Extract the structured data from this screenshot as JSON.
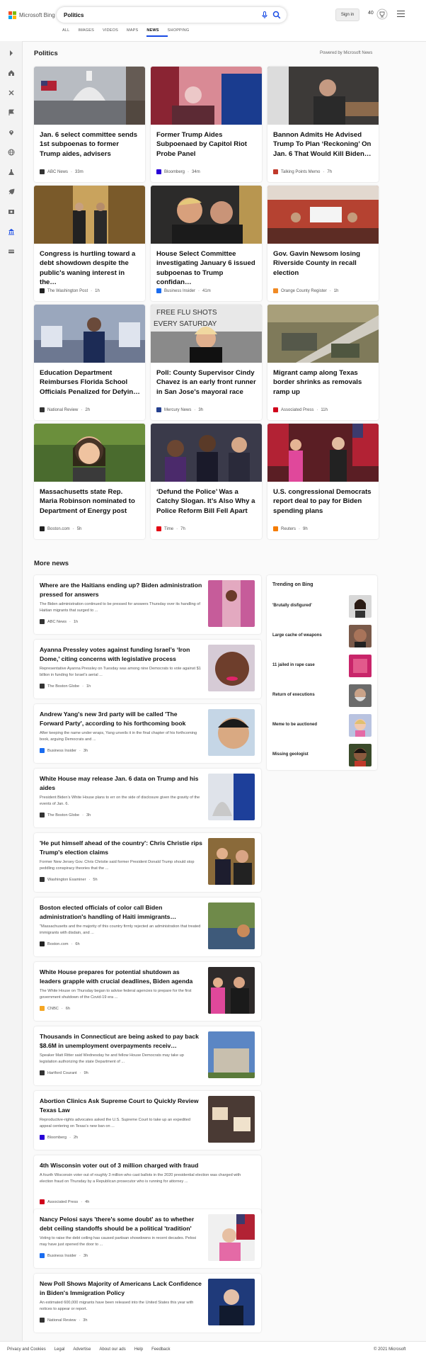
{
  "header": {
    "brand": "Microsoft Bing",
    "search_value": "Politics",
    "sign_in": "Sign in",
    "points": "40",
    "tabs": [
      {
        "label": "ALL"
      },
      {
        "label": "IMAGES"
      },
      {
        "label": "VIDEOS"
      },
      {
        "label": "MAPS"
      },
      {
        "label": "NEWS"
      },
      {
        "label": "SHOPPING"
      }
    ],
    "active_tab": "NEWS"
  },
  "section": {
    "title": "Politics",
    "powered_by": "Powered by Microsoft News"
  },
  "top_stories": [
    {
      "title": "Jan. 6 select committee sends 1st subpoenas to former Trump aides, advisers",
      "source": "ABC News",
      "time": "33m"
    },
    {
      "title": "Former Trump Aides Subpoenaed by Capitol Riot Probe Panel",
      "source": "Bloomberg",
      "time": "34m"
    },
    {
      "title": "Bannon Admits He Advised Trump To Plan ‘Reckoning’ On Jan. 6 That Would Kill Biden…",
      "source": "Talking Points Memo",
      "time": "7h"
    },
    {
      "title": "Congress is hurtling toward a debt showdown despite the public's waning interest in the…",
      "source": "The Washington Post",
      "time": "1h"
    },
    {
      "title": "House Select Committee investigating January 6 issued subpoenas to Trump confidan…",
      "source": "Business Insider",
      "time": "41m"
    },
    {
      "title": "Gov. Gavin Newsom losing Riverside County in recall election",
      "source": "Orange County Register",
      "time": "1h"
    },
    {
      "title": "Education Department Reimburses Florida School Officials Penalized for Defyin…",
      "source": "National Review",
      "time": "2h"
    },
    {
      "title": "Poll: County Supervisor Cindy Chavez is an early front runner in San Jose's mayoral race",
      "source": "Mercury News",
      "time": "3h"
    },
    {
      "title": "Migrant camp along Texas border shrinks as removals ramp up",
      "source": "Associated Press",
      "time": "11h"
    },
    {
      "title": "Massachusetts state Rep. Maria Robinson nominated to Department of Energy post",
      "source": "Boston.com",
      "time": "5h"
    },
    {
      "title": "‘Defund the Police’ Was a Catchy Slogan. It’s Also Why a Police Reform Bill Fell Apart",
      "source": "Time",
      "time": "7h"
    },
    {
      "title": "U.S. congressional Democrats report deal to pay for Biden spending plans",
      "source": "Reuters",
      "time": "9h"
    }
  ],
  "more_news": {
    "title": "More news",
    "items": [
      {
        "title": "Where are the Haitians ending up? Biden administration pressed for answers",
        "desc": "The Biden administration continued to be pressed for answers Thursday over its handling of Haitian migrants that surged to ...",
        "source": "ABC News",
        "time": "1h"
      },
      {
        "title": "Ayanna Pressley votes against funding Israel’s ‘Iron Dome,’ citing concerns with legislative process",
        "desc": "Representative Ayanna Pressley on Tuesday was among nine Democrats to vote against $1 billion in funding for Israel’s aerial ...",
        "source": "The Boston Globe",
        "time": "1h"
      },
      {
        "title": "Andrew Yang's new 3rd party will be called 'The Forward Party', according to his forthcoming book",
        "desc": "After keeping the name under wraps, Yang unveils it in the final chapter of his forthcoming book, arguing Democrats and ...",
        "source": "Business Insider",
        "time": "3h"
      },
      {
        "title": "White House may release Jan. 6 data on Trump and his aides",
        "desc": "President Biden’s White House plans to err on the side of disclosure given the gravity of the events of Jan. 6.",
        "source": "The Boston Globe",
        "time": "3h"
      },
      {
        "title": "'He put himself ahead of the country': Chris Christie rips Trump's election claims",
        "desc": "Former New Jersey Gov. Chris Christie said former President Donald Trump should stop peddling conspiracy theories that the ...",
        "source": "Washington Examiner",
        "time": "5h"
      },
      {
        "title": "Boston elected officials of color call Biden administration's handling of Haiti immigrants…",
        "desc": "\"Massachusetts and the majority of this country firmly rejected an administration that treated immigrants with disdain, and ...",
        "source": "Boston.com",
        "time": "6h"
      },
      {
        "title": "White House prepares for potential shutdown as leaders grapple with crucial deadlines, Biden agenda",
        "desc": "The White House on Thursday began to advise federal agencies to prepare for the first government shutdown of the Covid-19 era ...",
        "source": "CNBC",
        "time": "6h"
      },
      {
        "title": "Thousands in Connecticut are being asked to pay back $8.6M in unemployment overpayments receiv…",
        "desc": "Speaker Matt Ritter said Wednesday he and fellow House Democrats may take up legislation authorizing the state Department of ...",
        "source": "Hartford Courant",
        "time": "9h"
      },
      {
        "title": "Abortion Clinics Ask Supreme Court to Quickly Review Texas Law",
        "desc": "Reproductive-rights advocates asked the U.S. Supreme Court to take up an expedited appeal centering on Texas’s new ban on ...",
        "source": "Bloomberg",
        "time": "2h"
      },
      {
        "title": "4th Wisconsin voter out of 3 million charged with fraud",
        "desc": "A fourth Wisconsin voter out of roughly 3 million who cast ballots in the 2020 presidential election was charged with election fraud on Thursday by a Republican prosecutor who is running for attorney ...",
        "source": "Associated Press",
        "time": "4h"
      },
      {
        "title": "Nancy Pelosi says 'there's some doubt' as to whether debt ceiling standoffs should be a political 'tradition'",
        "desc": "Voting to raise the debt ceiling has caused partisan showdowns in recent decades. Pelosi may have just opened the door to ...",
        "source": "Business Insider",
        "time": "3h"
      },
      {
        "title": "New Poll Shows Majority of Americans Lack Confidence in Biden's Immigration Policy",
        "desc": "An estimated 600,000 migrants have been released into the United States this year with notices to appear or report.",
        "source": "National Review",
        "time": "3h"
      }
    ]
  },
  "trending": {
    "title": "Trending on Bing",
    "items": [
      {
        "label": "'Brutally disfigured'"
      },
      {
        "label": "Large cache of weapons"
      },
      {
        "label": "11 jailed in rape case"
      },
      {
        "label": "Return of executions"
      },
      {
        "label": "Meme to be auctioned"
      },
      {
        "label": "Missing geologist"
      }
    ]
  },
  "footer": {
    "links": [
      {
        "label": "Privacy and Cookies"
      },
      {
        "label": "Legal"
      },
      {
        "label": "Advertise"
      },
      {
        "label": "About our ads"
      },
      {
        "label": "Help"
      },
      {
        "label": "Feedback"
      }
    ],
    "copyright": "© 2021 Microsoft"
  },
  "colors": {
    "accent": "#174ae4",
    "brand_red": "#f25022",
    "brand_green": "#7fba00",
    "brand_blue": "#00a4ef",
    "brand_yellow": "#ffb900"
  }
}
